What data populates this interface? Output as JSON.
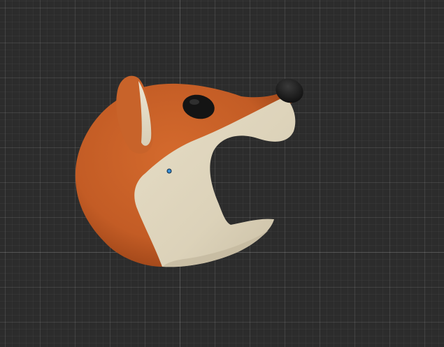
{
  "viewport": {
    "name": "3D viewport",
    "object": "fox-head-model"
  },
  "colors": {
    "background": "#2c2c2c",
    "fur_orange": "#c8622a",
    "fur_orange_dark": "#a44b1c",
    "fur_cream": "#ddd4bd",
    "fur_cream_shadow": "#c4b99f",
    "nose_black": "#141414",
    "pivot_blue": "#3a8fd6"
  }
}
